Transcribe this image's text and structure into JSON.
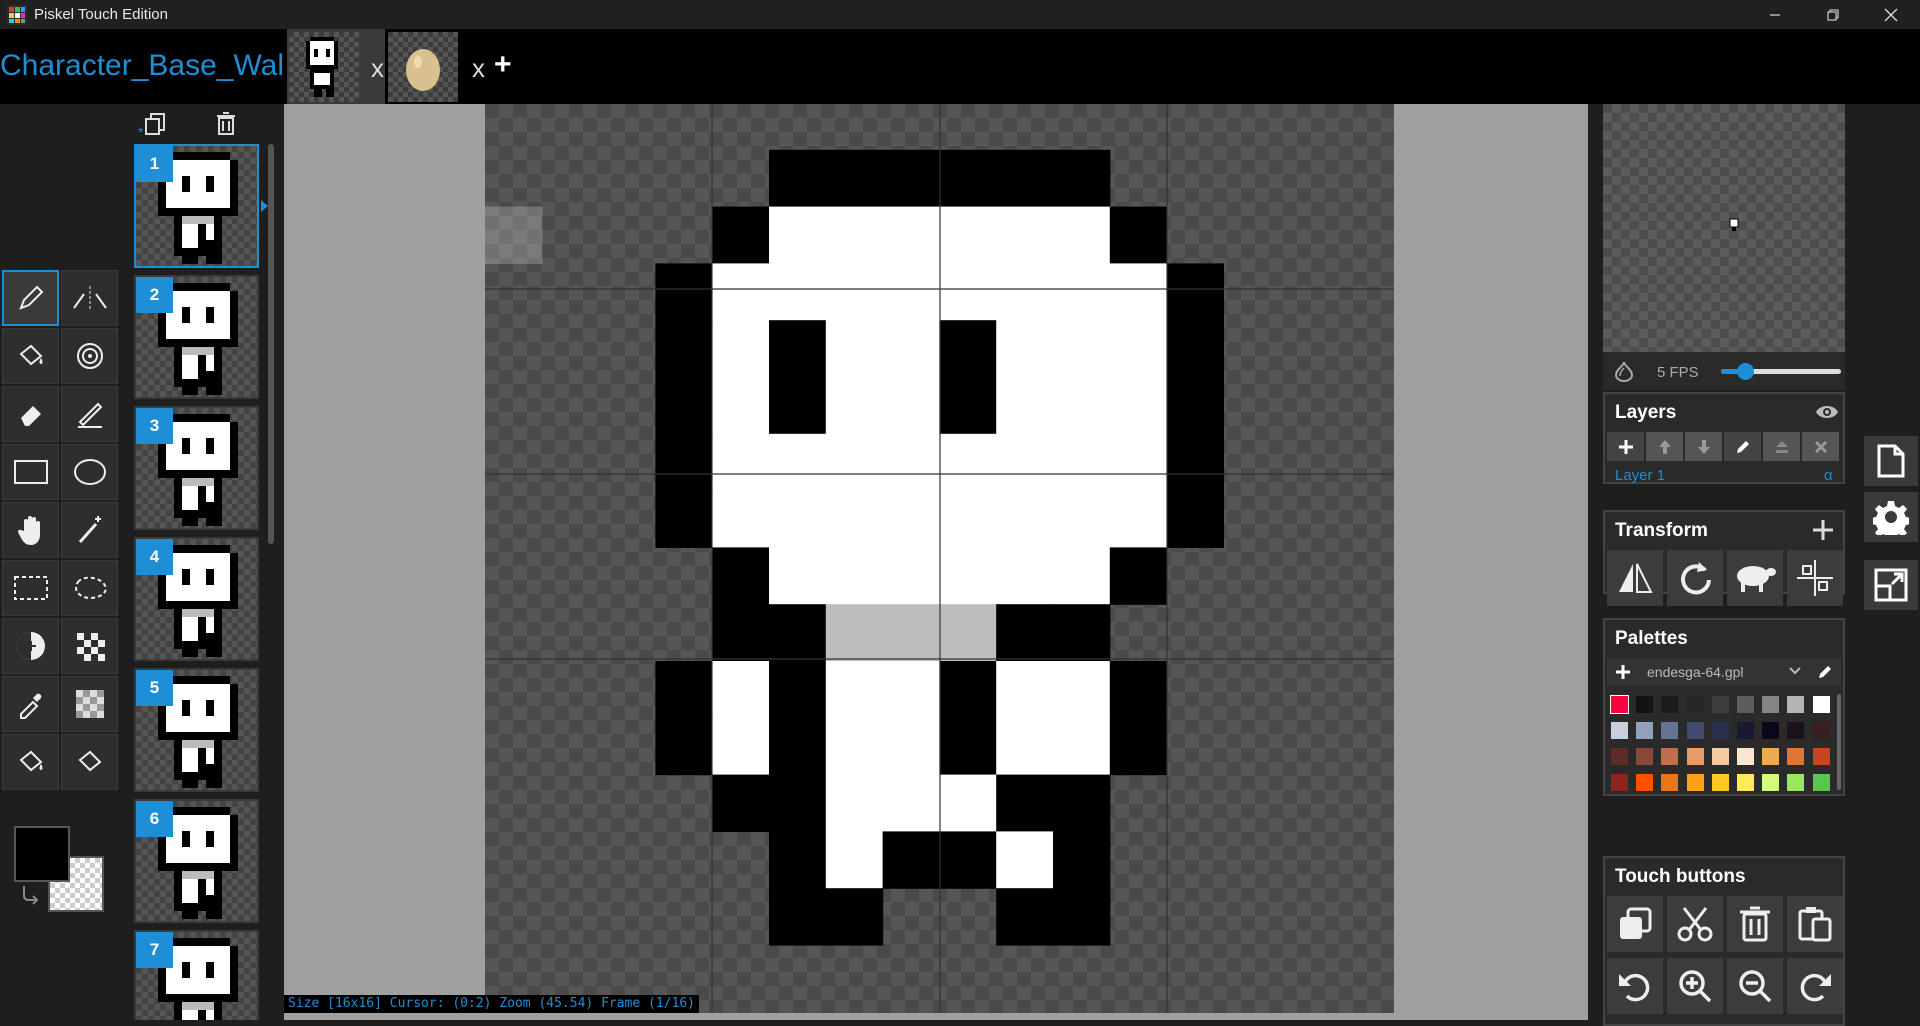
{
  "window": {
    "title": "Piskel Touch Edition"
  },
  "tabs": {
    "project_title": "Character_Base_Wal",
    "close_label": "x",
    "add_label": "+"
  },
  "frames": {
    "numbers": [
      "1",
      "2",
      "3",
      "4",
      "5",
      "6",
      "7"
    ],
    "selected": "1"
  },
  "status": {
    "text": "Size [16x16] Cursor: (0:2) Zoom (45.54) Frame (1/16)"
  },
  "preview": {
    "fps_label": "5 FPS",
    "fps_value": 5,
    "fps_fraction": 0.2
  },
  "layers": {
    "title": "Layers",
    "items": [
      {
        "name": "Layer 1",
        "opacity_symbol": "α"
      }
    ]
  },
  "transform": {
    "title": "Transform"
  },
  "palettes": {
    "title": "Palettes",
    "selected": "endesga-64.gpl",
    "colors": [
      "#ff0040",
      "#131313",
      "#1b1b1b",
      "#272727",
      "#3d3d3d",
      "#5d5d5d",
      "#858585",
      "#b4b4b4",
      "#ffffff",
      "#c7cfdd",
      "#92a1b9",
      "#657392",
      "#424c6e",
      "#2a2f4e",
      "#1a1932",
      "#0e071b",
      "#1c121c",
      "#391f21",
      "#5d2c28",
      "#8a4836",
      "#bf6f4a",
      "#e69c69",
      "#f6ca9f",
      "#f9e6cf",
      "#edab50",
      "#e07438",
      "#c64524",
      "#8e251d",
      "#ff5000",
      "#ed7614",
      "#ffa214",
      "#ffc825",
      "#ffeb57",
      "#d3fc7e",
      "#99e65f",
      "#5ac54f",
      "#33984b",
      "#1e6f50",
      "#134c4c",
      "#0c2e44",
      "#00396d",
      "#0069aa",
      "#0098dc",
      "#00cdf9",
      "#0cf1ff",
      "#94fdff",
      "#fdd2ed",
      "#f389f5",
      "#db3ffd",
      "#7a09fa",
      "#3003d9",
      "#0c0293",
      "#03193f",
      "#3b1443"
    ]
  },
  "touch": {
    "title": "Touch buttons"
  },
  "colors": {
    "accent": "#1e8fd6",
    "primary": "#000000"
  }
}
